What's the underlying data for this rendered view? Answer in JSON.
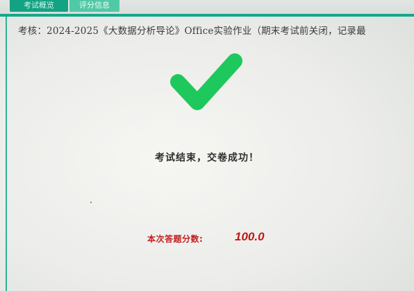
{
  "tabs": [
    {
      "label": "考试概览",
      "active": true
    },
    {
      "label": "评分信息",
      "active": false
    }
  ],
  "exam": {
    "title": "考核：2024-2025《大数据分析导论》Office实验作业（期末考试前关闭，记录最"
  },
  "result": {
    "status_icon": "checkmark-icon",
    "message": "考试结束，交卷成功！",
    "score_label": "本次答题分数:",
    "score_value": "100.0"
  },
  "colors": {
    "accent": "#12a98a",
    "check": "#1fc85c",
    "score": "#c21717"
  }
}
